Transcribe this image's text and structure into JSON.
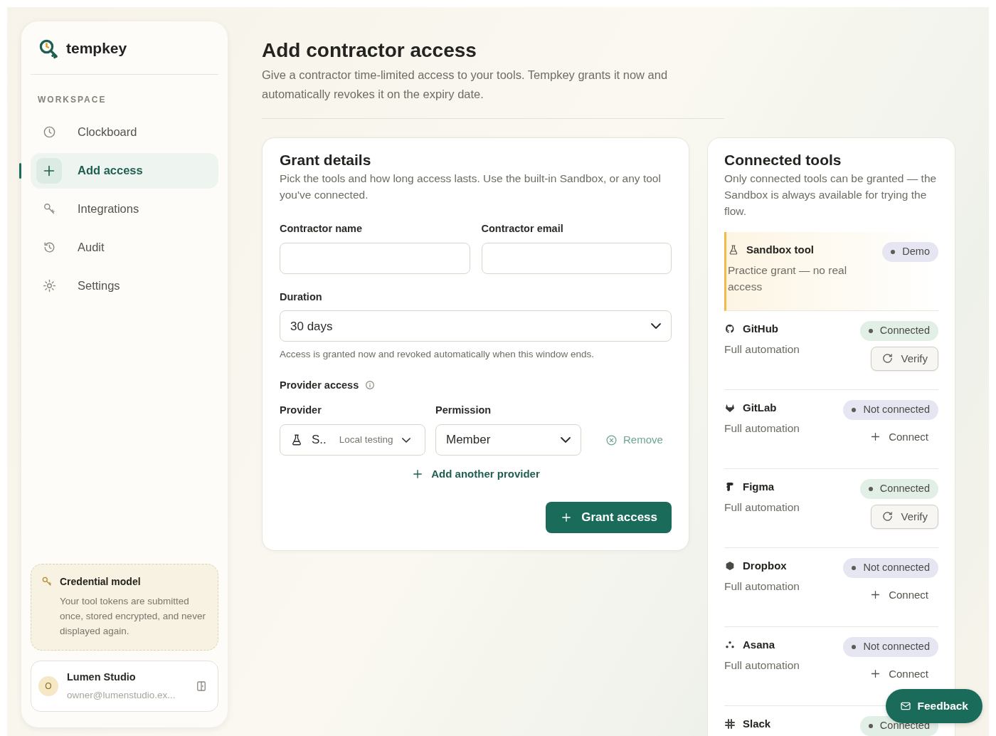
{
  "brand": {
    "name": "tempkey"
  },
  "sidebar": {
    "section": "WORKSPACE",
    "items": [
      {
        "label": "Clockboard",
        "selected": false
      },
      {
        "label": "Add access",
        "selected": true
      },
      {
        "label": "Integrations",
        "selected": false
      },
      {
        "label": "Audit",
        "selected": false
      },
      {
        "label": "Settings",
        "selected": false
      }
    ],
    "note": {
      "title": "Credential model",
      "text": "Your tool tokens are submitted once, stored encrypted, and never displayed again."
    },
    "account": {
      "initial": "O",
      "name": "Lumen Studio",
      "email": "owner@lumenstudio.ex..."
    }
  },
  "header": {
    "title": "Add contractor access",
    "subtitle": "Give a contractor time-limited access to your tools. Tempkey grants it now and automatically revokes it on the expiry date."
  },
  "grant": {
    "title": "Grant details",
    "subtitle": "Pick the tools and how long access lasts. Use the built-in Sandbox, or any tool you've connected.",
    "fields": [
      {
        "label": "Contractor name"
      },
      {
        "label": "Contractor email"
      }
    ],
    "duration": {
      "label": "Duration",
      "value": "30 days",
      "hint": "Access is granted now and revoked automatically when this window ends."
    },
    "provider_access": {
      "label": "Provider access",
      "provider_label": "Provider",
      "permission_label": "Permission",
      "rows": [
        {
          "provider": "S..",
          "provider_note": "Local testing",
          "permission": "Member",
          "remove": "Remove"
        }
      ],
      "add": "Add another provider"
    },
    "submit": "Grant access"
  },
  "tools": {
    "title": "Connected tools",
    "subtitle": "Only connected tools can be granted — the Sandbox is always available for trying the flow.",
    "items": [
      {
        "name": "Sandbox tool",
        "detail": "Practice grant — no real access",
        "status": "Demo",
        "kind": "sandbox"
      },
      {
        "name": "GitHub",
        "detail": "Full automation",
        "status": "Connected",
        "kind": "connected",
        "action": "Verify"
      },
      {
        "name": "GitLab",
        "detail": "Full automation",
        "status": "Not connected",
        "kind": "disconnected",
        "action": "Connect"
      },
      {
        "name": "Figma",
        "detail": "Full automation",
        "status": "Connected",
        "kind": "connected",
        "action": "Verify"
      },
      {
        "name": "Dropbox",
        "detail": "Full automation",
        "status": "Not connected",
        "kind": "disconnected",
        "action": "Connect"
      },
      {
        "name": "Asana",
        "detail": "Full automation",
        "status": "Not connected",
        "kind": "disconnected",
        "action": "Connect"
      },
      {
        "name": "Slack",
        "status": "Connected",
        "kind": "connected"
      }
    ]
  },
  "feedback": "Feedback"
}
